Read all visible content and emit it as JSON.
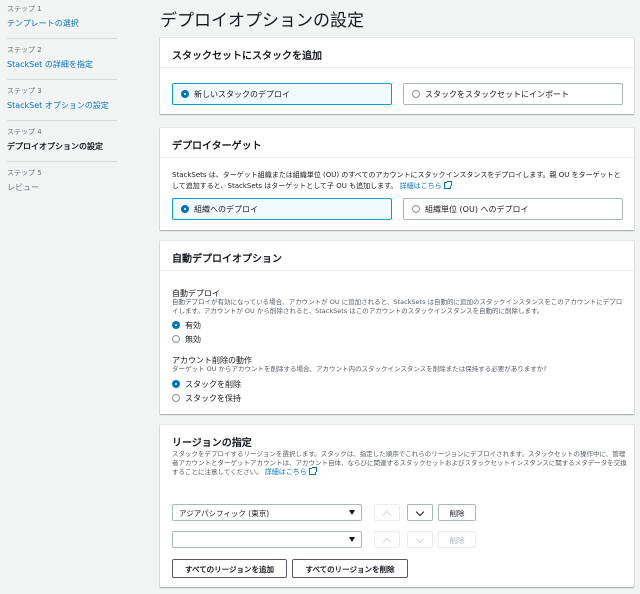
{
  "sidebar": {
    "steps": [
      {
        "num": "ステップ 1",
        "label": "テンプレートの選択"
      },
      {
        "num": "ステップ 2",
        "label": "StackSet の詳細を指定"
      },
      {
        "num": "ステップ 3",
        "label": "StackSet オプションの設定"
      },
      {
        "num": "ステップ 4",
        "label": "デプロイオプションの設定"
      },
      {
        "num": "ステップ 5",
        "label": "レビュー"
      }
    ]
  },
  "page_title": "デプロイオプションの設定",
  "add_stacks": {
    "header": "スタックセットにスタックを追加",
    "option_new": "新しいスタックのデプロイ",
    "option_import": "スタックをスタックセットにインポート"
  },
  "deploy_target": {
    "header": "デプロイターゲット",
    "description": "StackSets は、ターゲット組織または組織単位 (OU) のすべてのアカウントにスタックインスタンスをデプロイします。親 OU をターゲットとして追加すると、StackSets はターゲットとして子 OU も追加します。",
    "learn_more": "詳細はこちら",
    "option_org": "組織へのデプロイ",
    "option_ou": "組織単位 (OU) へのデプロイ"
  },
  "auto_deploy": {
    "header": "自動デプロイオプション",
    "auto_label": "自動デプロイ",
    "auto_desc": "自動デプロイが有効になっている場合、アカウントが OU に追加されると、StackSets は自動的に追加のスタックインスタンスをこのアカウントにデプロイします。アカウントが OU から削除されると、StackSets はこのアカウントのスタックインスタンスを自動的に削除します。",
    "enabled": "有効",
    "disabled": "無効",
    "removal_label": "アカウント削除の動作",
    "removal_desc": "ターゲット OU からアカウントを削除する場合、アカウント内のスタックインスタンスを削除または保持する必要がありますか?",
    "delete_stack": "スタックを削除",
    "retain_stack": "スタックを保持"
  },
  "regions": {
    "header": "リージョンの指定",
    "description": "スタックをデプロイするリージョンを選択します。スタックは、指定した順序でこれらのリージョンにデプロイされます。スタックセットの操作中に、管理者アカウントとターゲットアカウントは、アカウント自体、ならびに関連するスタックセットおよびスタックセットインスタンスに関するメタデータを交換することに注意してください。",
    "learn_more": "詳細はこちら",
    "selected_region": "アジアパシフィック (東京)",
    "empty_region": "",
    "remove_label": "削除",
    "add_all": "すべてのリージョンを追加",
    "remove_all": "すべてのリージョンを削除"
  }
}
